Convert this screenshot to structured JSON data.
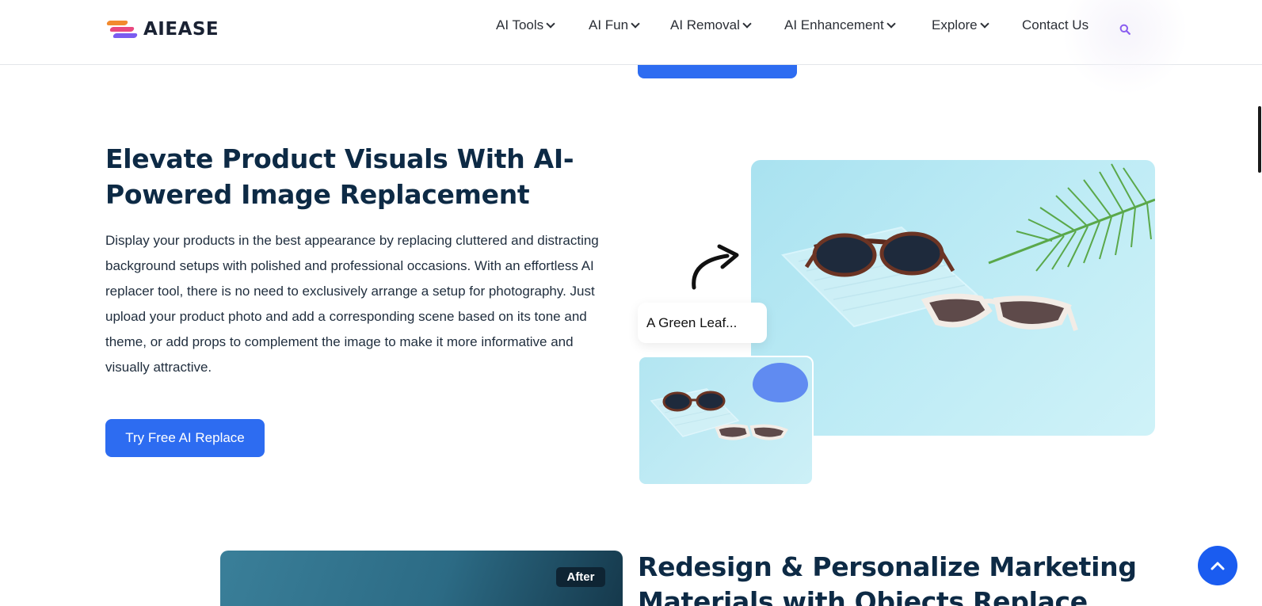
{
  "header": {
    "logo_text": "AIEASE",
    "nav": [
      {
        "label": "AI Tools",
        "has_dropdown": true
      },
      {
        "label": "AI Fun",
        "has_dropdown": true
      },
      {
        "label": "AI Removal",
        "has_dropdown": true
      },
      {
        "label": "AI Enhancement",
        "has_dropdown": true
      },
      {
        "label": "Explore",
        "has_dropdown": true
      },
      {
        "label": "Contact Us",
        "has_dropdown": false
      }
    ],
    "search_icon": "search-icon"
  },
  "section1": {
    "title": "Elevate Product Visuals With AI-Powered Image Replacement",
    "body": "Display your products in the best appearance by replacing cluttered and distracting background setups with polished and professional occasions. With an effortless AI replacer tool, there is no need to exclusively arrange a setup for photography. Just upload your product photo and add a corresponding scene based on its tone and theme, or add props to complement the image to make it more informative and visually attractive.",
    "cta_label": "Try Free AI Replace",
    "prompt_text": "A Green Leaf..."
  },
  "section2": {
    "badge": "After",
    "title": "Redesign & Personalize Marketing Materials with Objects Replace"
  },
  "colors": {
    "accent": "#2d6cf1",
    "heading": "#0d2a45",
    "fab": "#1a5cf0"
  }
}
